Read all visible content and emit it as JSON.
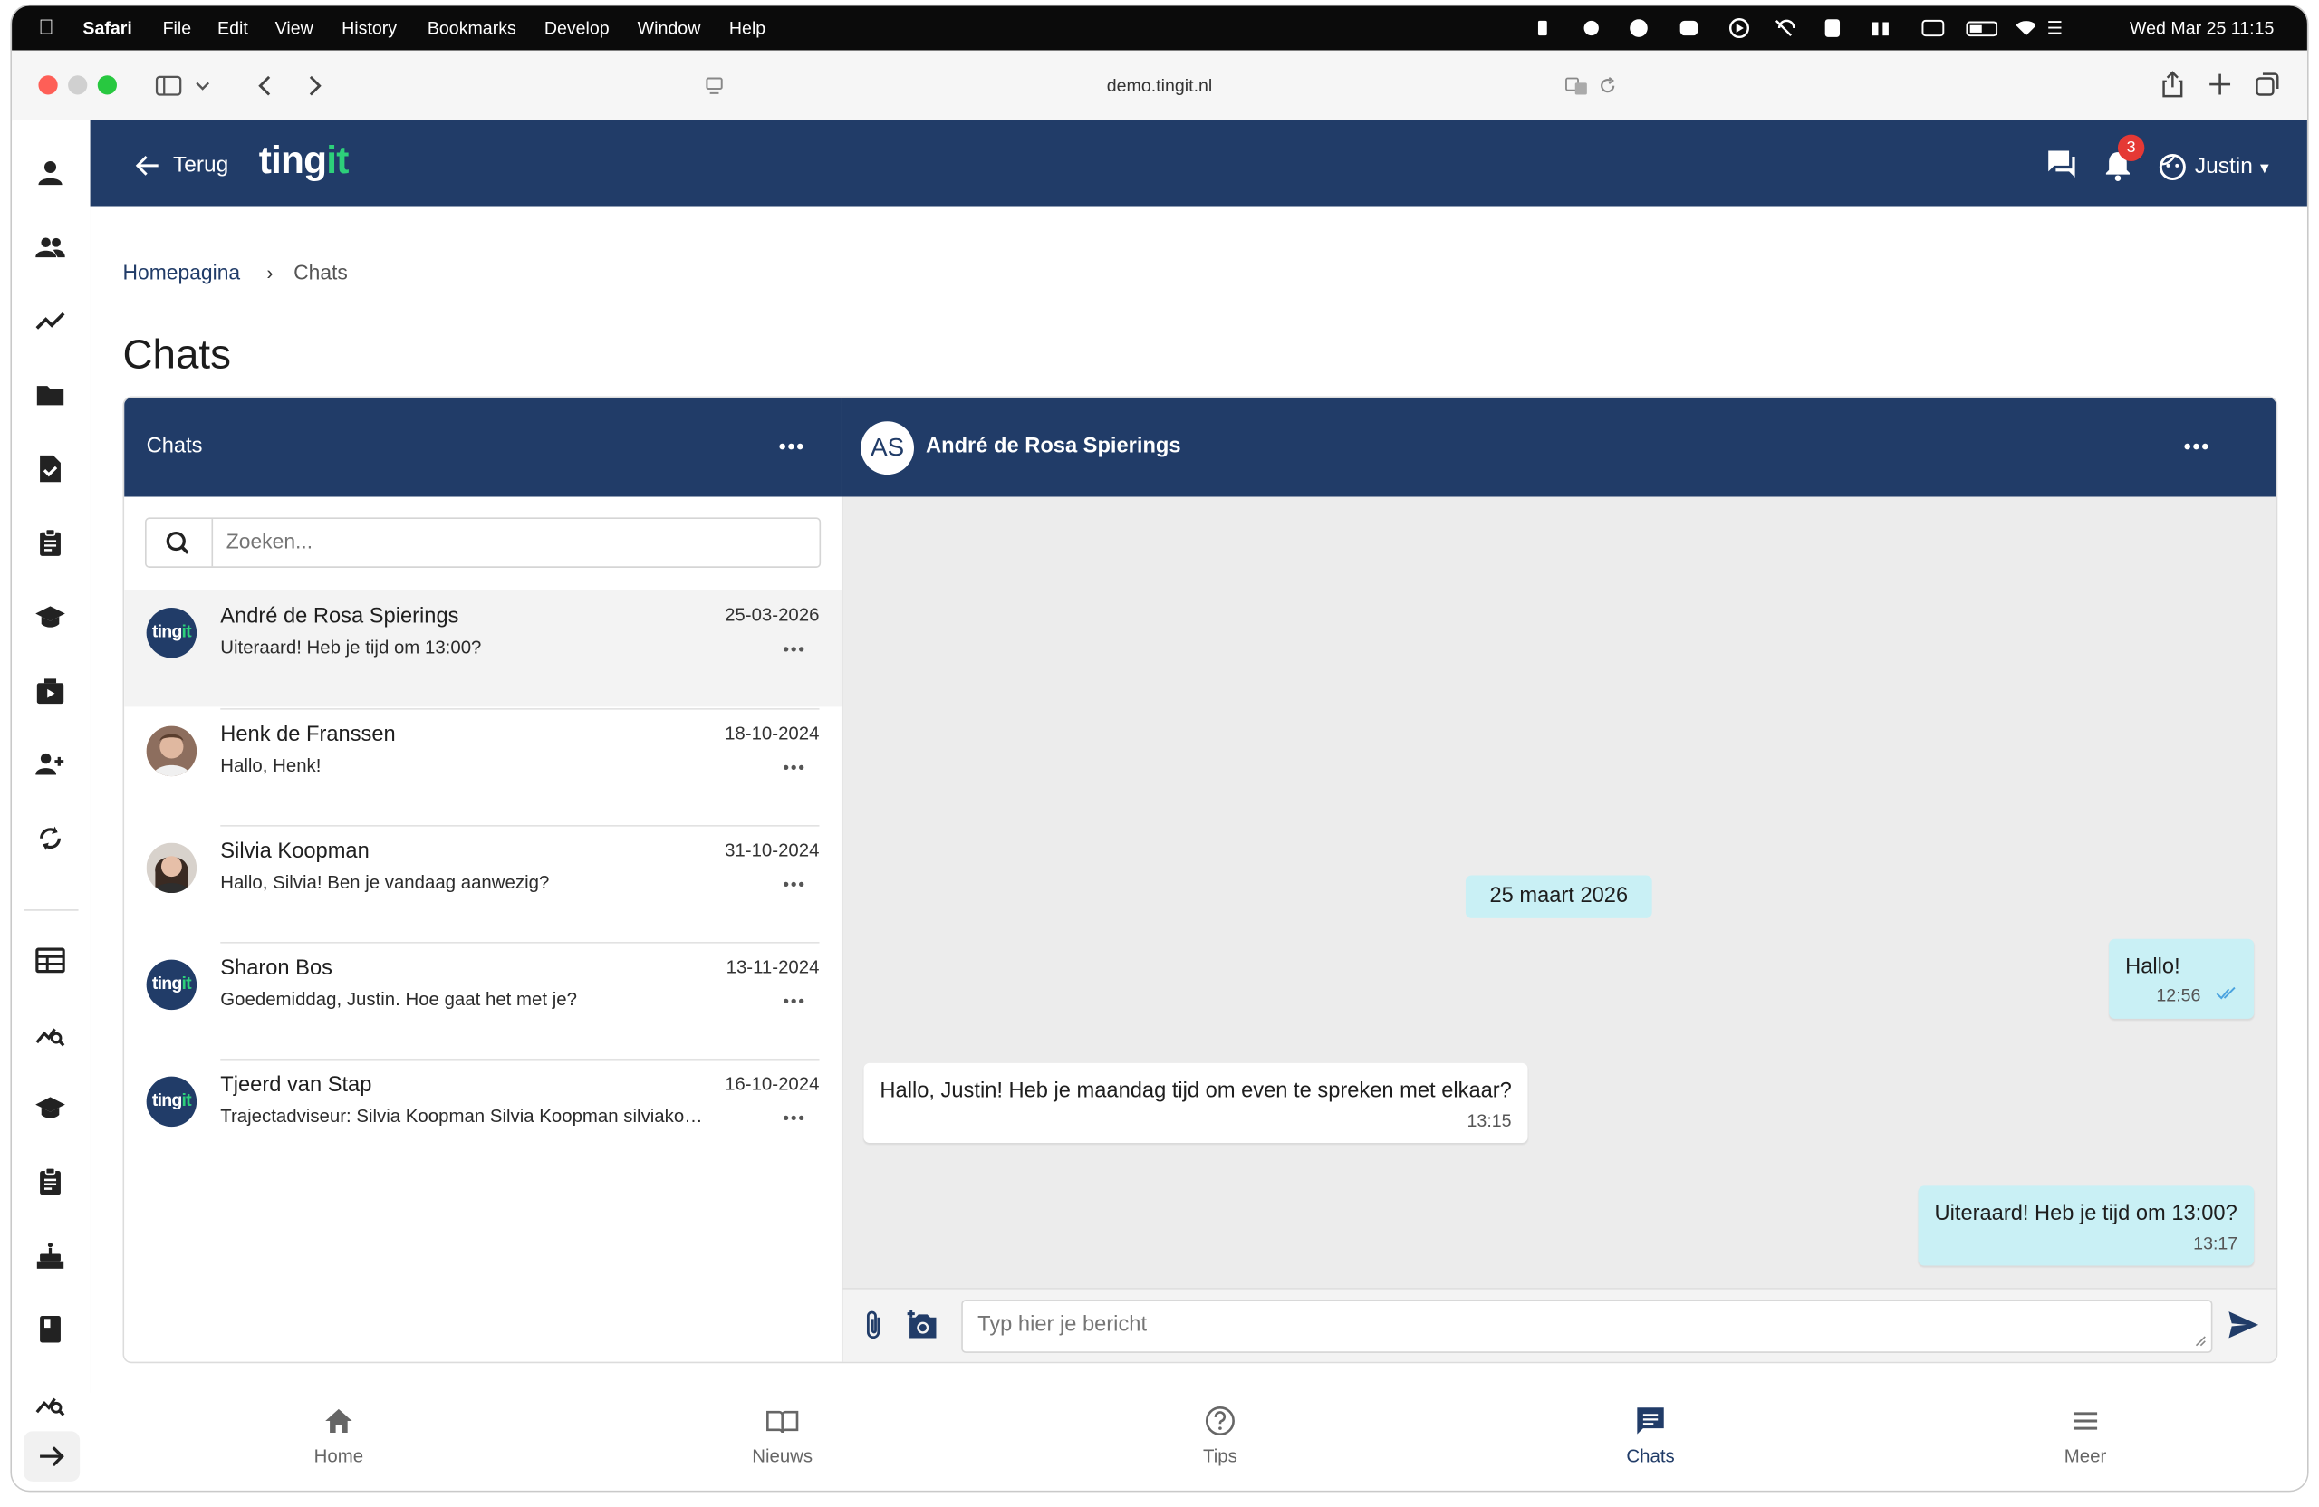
{
  "os_menubar": {
    "app": "Safari",
    "menus": [
      "File",
      "Edit",
      "View",
      "History",
      "Bookmarks",
      "Develop",
      "Window",
      "Help"
    ],
    "clock": "Wed Mar 25  11:15"
  },
  "browser": {
    "url": "demo.tingit.nl"
  },
  "header": {
    "back_label": "Terug",
    "logo_text": "tingit",
    "notification_count": "3",
    "user_name": "Justin"
  },
  "breadcrumb": {
    "home": "Homepagina",
    "current": "Chats"
  },
  "page_title": "Chats",
  "chat_list": {
    "title": "Chats",
    "search_placeholder": "Zoeken...",
    "items": [
      {
        "name": "André de Rosa Spierings",
        "preview": "Uiteraard! Heb je tijd om 13:00?",
        "date": "25-03-2026",
        "avatar": "tingit-logo",
        "active": true
      },
      {
        "name": "Henk de Franssen",
        "preview": "Hallo, Henk!",
        "date": "18-10-2024",
        "avatar": "photo-man"
      },
      {
        "name": "Silvia Koopman",
        "preview": "Hallo, Silvia! Ben je vandaag aanwezig?",
        "date": "31-10-2024",
        "avatar": "photo-woman"
      },
      {
        "name": "Sharon Bos",
        "preview": "Goedemiddag, Justin. Hoe gaat het met je?",
        "date": "13-11-2024",
        "avatar": "tingit-logo"
      },
      {
        "name": "Tjeerd van Stap",
        "preview": "Trajectadviseur: Silvia Koopman Silvia Koopman silviakoopman@tingit.nl",
        "date": "16-10-2024",
        "avatar": "tingit-logo"
      }
    ]
  },
  "conversation": {
    "initials": "AS",
    "contact_name": "André de Rosa Spierings",
    "date_divider": "25 maart 2026",
    "messages": [
      {
        "text": "Hallo!",
        "time": "12:56",
        "direction": "outgoing",
        "read": true
      },
      {
        "text": "Hallo, Justin! Heb je maandag tijd om even te spreken met elkaar?",
        "time": "13:15",
        "direction": "incoming"
      },
      {
        "text": "Uiteraard! Heb je tijd om 13:00?",
        "time": "13:17",
        "direction": "outgoing"
      }
    ],
    "input_placeholder": "Typ hier je bericht"
  },
  "bottom_nav": [
    {
      "label": "Home",
      "icon": "home-icon"
    },
    {
      "label": "Nieuws",
      "icon": "book-icon"
    },
    {
      "label": "Tips",
      "icon": "help-circle-icon"
    },
    {
      "label": "Chats",
      "icon": "chat-icon",
      "active": true
    },
    {
      "label": "Meer",
      "icon": "menu-icon"
    }
  ],
  "colors": {
    "brand_navy": "#213c68",
    "brand_green": "#2dd07a",
    "outgoing_bubble": "#c9f0f5",
    "badge_red": "#e53935"
  }
}
